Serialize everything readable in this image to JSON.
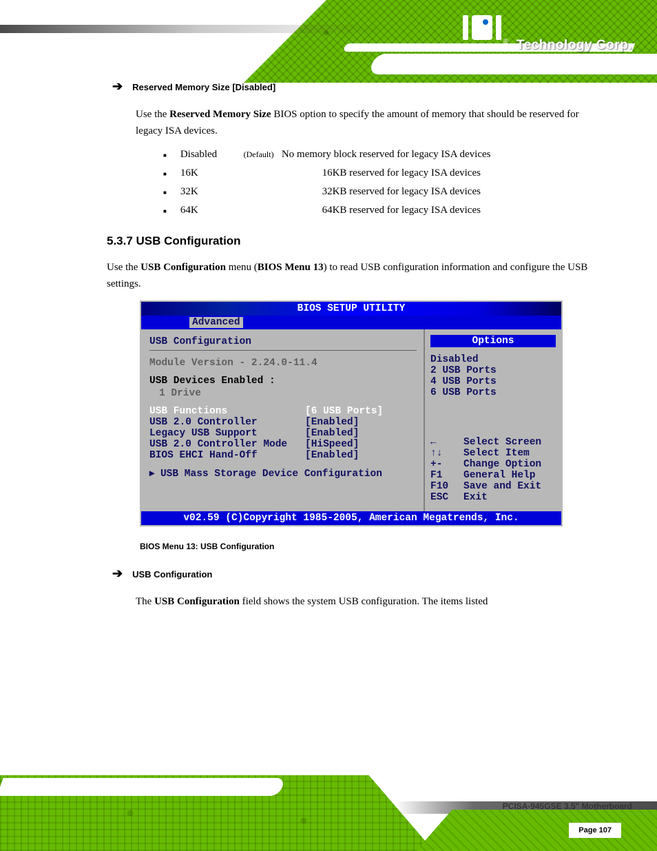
{
  "header": {
    "logo_text": "Technology Corp.",
    "logo_r": "®"
  },
  "section_top": {
    "item_label": "Reserved Memory Size [Disabled]",
    "item_desc_1": "Use the ",
    "item_desc_bold": "Reserved Memory Size",
    "item_desc_2": " BIOS option to specify the amount of memory that should be reserved for legacy ISA devices.",
    "options": [
      {
        "label": "Disabled",
        "default": "(Default)",
        "desc": "No memory block reserved for legacy ISA devices"
      },
      {
        "label": "16K",
        "default": "",
        "desc": "16KB reserved for legacy ISA devices"
      },
      {
        "label": "32K",
        "default": "",
        "desc": "32KB reserved for legacy ISA devices"
      },
      {
        "label": "64K",
        "default": "",
        "desc": "64KB reserved for legacy ISA devices"
      }
    ]
  },
  "section_usb": {
    "heading": "5.3.7 USB Configuration",
    "intro_1": "Use the ",
    "intro_bold": "USB Configuration",
    "intro_2": " menu (",
    "intro_ref": "BIOS Menu 13",
    "intro_3": ") to read USB configuration information and configure the USB settings."
  },
  "bios": {
    "title": "BIOS SETUP UTILITY",
    "tab": "Advanced",
    "left": {
      "heading": "USB Configuration",
      "module": "Module Version - 2.24.0-11.4",
      "devices_label": "USB Devices Enabled :",
      "drive": "1 Drive",
      "rows": [
        {
          "label": "USB Functions",
          "value": "[6 USB Ports]",
          "white": true
        },
        {
          "label": "USB 2.0 Controller",
          "value": "[Enabled]",
          "white": false
        },
        {
          "label": "Legacy USB Support",
          "value": "[Enabled]",
          "white": false
        },
        {
          "label": "USB 2.0 Controller Mode",
          "value": "[HiSpeed]",
          "white": false
        },
        {
          "label": "BIOS EHCI Hand-Off",
          "value": "[Enabled]",
          "white": false
        }
      ],
      "submenu": "▸ USB Mass Storage Device Configuration"
    },
    "right": {
      "opt_header": "Options",
      "options": [
        "Disabled",
        "2 USB Ports",
        "4 USB Ports",
        "6 USB Ports"
      ],
      "nav": [
        {
          "k": "←",
          "t": "Select Screen"
        },
        {
          "k": "↑↓",
          "t": "Select Item"
        },
        {
          "k": "+-",
          "t": "Change Option"
        },
        {
          "k": "F1",
          "t": "General Help"
        },
        {
          "k": "F10",
          "t": "Save and Exit"
        },
        {
          "k": "ESC",
          "t": "Exit"
        }
      ]
    },
    "footer": "v02.59 (C)Copyright 1985-2005, American Megatrends, Inc."
  },
  "figure_caption": "BIOS Menu 13: USB Configuration",
  "section_bottom": {
    "item_label": "USB Configuration",
    "item_desc_1": "The ",
    "item_desc_bold": "USB Configuration",
    "item_desc_2": " field shows the system USB configuration. The items listed"
  },
  "footer": {
    "page_title": "PCISA-945GSE 3.5\" Motherboard",
    "page_num": "Page 107"
  }
}
